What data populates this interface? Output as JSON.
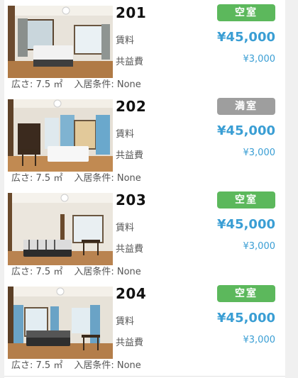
{
  "listings": [
    {
      "room": "201",
      "status": "空室",
      "status_type": "vacant",
      "rent_label": "賃料",
      "rent": "¥45,000",
      "fee_label": "共益費",
      "fee": "¥3,000",
      "area": "広さ: 7.5 ㎡",
      "condition": "入居条件: None"
    },
    {
      "room": "202",
      "status": "満室",
      "status_type": "full",
      "rent_label": "賃料",
      "rent": "¥45,000",
      "fee_label": "共益費",
      "fee": "¥3,000",
      "area": "広さ: 7.5 ㎡",
      "condition": "入居条件: None"
    },
    {
      "room": "203",
      "status": "空室",
      "status_type": "vacant",
      "rent_label": "賃料",
      "rent": "¥45,000",
      "fee_label": "共益費",
      "fee": "¥3,000",
      "area": "広さ: 7.5 ㎡",
      "condition": "入居条件: None"
    },
    {
      "room": "204",
      "status": "空室",
      "status_type": "vacant",
      "rent_label": "賃料",
      "rent": "¥45,000",
      "fee_label": "共益費",
      "fee": "¥3,000",
      "area": "広さ: 7.5 ㎡",
      "condition": "入居条件: None"
    }
  ],
  "colors": {
    "vacant": "#5cb85c",
    "full": "#9e9e9e",
    "price": "#3a9ed4"
  }
}
